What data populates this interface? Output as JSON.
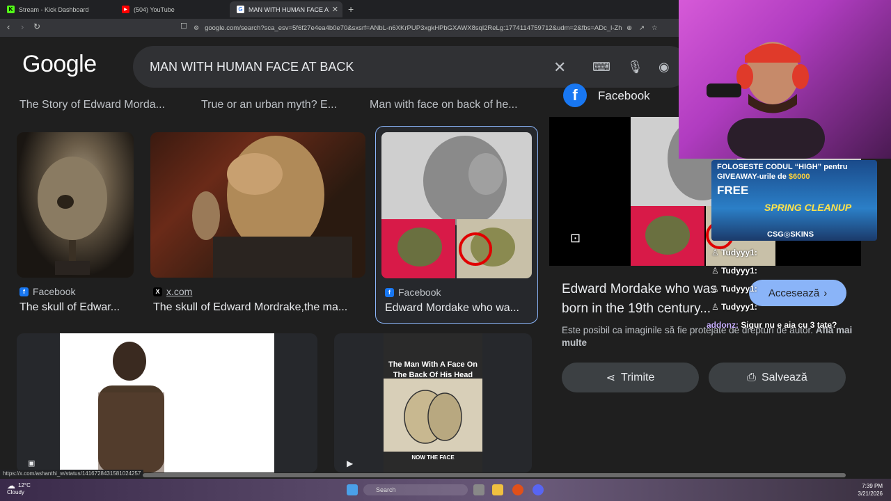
{
  "browser": {
    "tabs": [
      {
        "label": "Stream - Kick Dashboard",
        "icon": "kick-icon"
      },
      {
        "label": "(504) YouTube",
        "icon": "youtube-icon"
      },
      {
        "label": "MAN WITH HUMAN FACE AT BA",
        "icon": "google-icon"
      }
    ],
    "url": "google.com/search?sca_esv=5f6f27e4ea4b0e70&sxsrf=ANbL-n6XKrPUP3xgkHPbGXAWX8sql2ReLg:1774114759712&udm=2&fbs=ADc_l-Zh6vg..."
  },
  "google": {
    "logo": "Google",
    "query": "MAN WITH HUMAN FACE AT BACK",
    "top_captions": [
      "The Story of Edward Morda...",
      "True or an urban myth? E...",
      "Man with face on back of he..."
    ],
    "results": [
      {
        "source": "Facebook",
        "title": "The skull of Edwar..."
      },
      {
        "source": "x.com",
        "title": "The skull of Edward Mordrake,the ma..."
      },
      {
        "source": "Facebook",
        "title": "Edward Mordake who wa..."
      }
    ],
    "video_thumb_text": "The Man With A Face On The Back Of His Head",
    "video_thumb_subtitle": "NOW THE FACE"
  },
  "panel": {
    "source": "Facebook",
    "title": "Edward Mordake who was born in the 19th century...",
    "visit_label": "Accesează",
    "copyright": "Este posibil ca imaginile să fie protejate de drepturi de autor.",
    "learn_more": "Află mai multe",
    "share_label": "Trimite",
    "save_label": "Salvează"
  },
  "stream": {
    "promo_line1": "FOLOSESTE CODUL “HIGH” pentru",
    "promo_line2_a": "GIVEAWAY-urile de ",
    "promo_line2_b": "$6000",
    "promo_free": "FREE",
    "promo_spring": "SPRING CLEANUP",
    "promo_brand": "CSG◎SKINS",
    "chat_users": [
      "Tudyyy1:",
      "Tudyyy1:",
      "Tudyyy1:",
      "Tudyyy1:"
    ],
    "chat_user2": "addonz:",
    "chat_msg": "Sigur nu e aia cu 3 tate?"
  },
  "status": {
    "hover_url": "https://x.com/ashanthi_w/status/1416728431581024257"
  },
  "taskbar": {
    "temp": "12°C",
    "weather": "Cloudy",
    "search": "Search",
    "time": "7:39 PM",
    "date": "3/21/2026"
  }
}
